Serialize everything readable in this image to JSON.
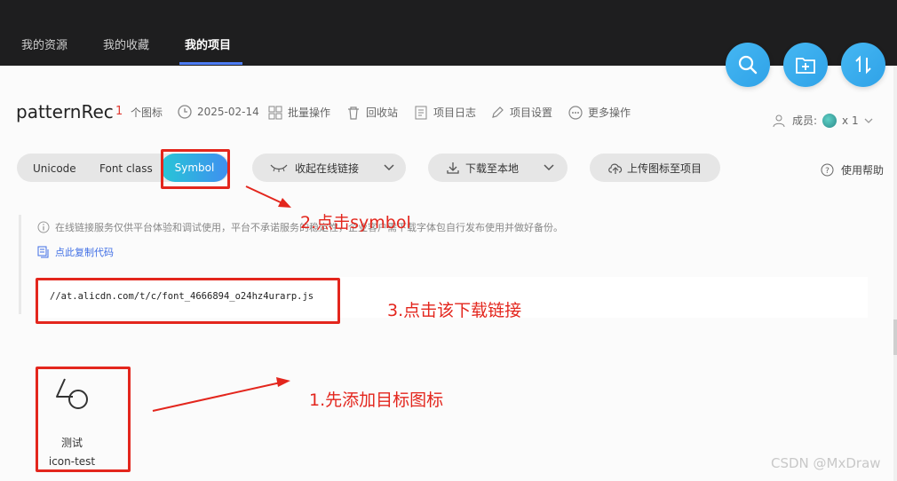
{
  "top_tabs": [
    "我的资源",
    "我的收藏",
    "我的项目"
  ],
  "fab_icons": [
    "search-icon",
    "add-folder-icon",
    "sort-icon"
  ],
  "project": {
    "name": "patternRec",
    "icon_count": "1",
    "icon_count_label": "个图标",
    "date": "2025-02-14",
    "actions": [
      "批量操作",
      "回收站",
      "项目日志",
      "项目设置",
      "更多操作"
    ]
  },
  "members": {
    "label": "成员:",
    "count": "x 1"
  },
  "toolbar": {
    "format_tabs": [
      "Unicode",
      "Font class",
      "Symbol"
    ],
    "selected_format": "Symbol",
    "collapse_link": "收起在线链接",
    "download": "下载至本地",
    "upload": "上传图标至项目",
    "help": "使用帮助"
  },
  "notice": "在线链接服务仅供平台体验和调试使用，平台不承诺服务的稳定性，企业客户需下载字体包自行发布使用并做好备份。",
  "copy_code": "点此复制代码",
  "code_url": "//at.alicdn.com/t/c/font_4666894_o24hz4urarp.js",
  "annotations": {
    "step1": "1.先添加目标图标",
    "step2": "2.点击symbol",
    "step3": "3.点击该下载链接"
  },
  "icon_card": {
    "name": "测试",
    "code": "icon-test"
  },
  "watermark": "CSDN @MxDraw",
  "colors": {
    "accent": "#4c7cf3",
    "annotation_red": "#e3261d",
    "symbol_gradient_start": "#27c6d6",
    "symbol_gradient_end": "#3f8ff0"
  }
}
